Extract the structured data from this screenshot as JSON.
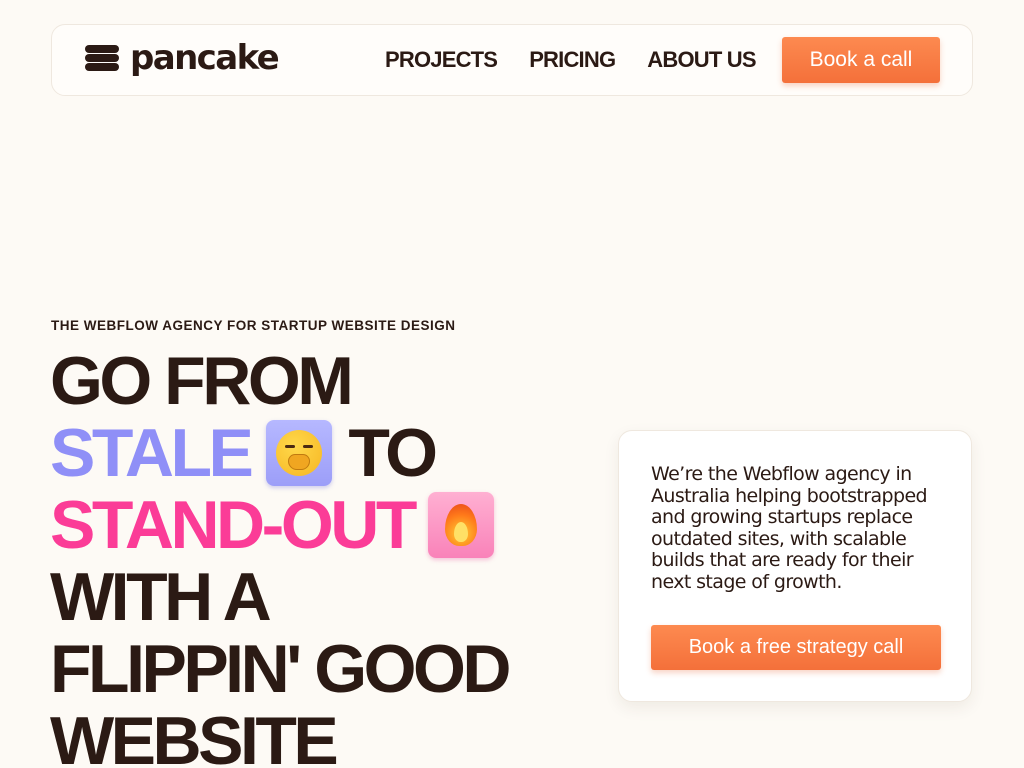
{
  "brand": {
    "name": "pancake"
  },
  "nav": {
    "links": [
      "PROJECTS",
      "PRICING",
      "ABOUT US"
    ],
    "cta": "Book a call"
  },
  "hero": {
    "eyebrow": "THE WEBFLOW AGENCY FOR STARTUP WEBSITE DESIGN",
    "headline": {
      "line1": "GO FROM",
      "stale": "STALE",
      "to": "TO",
      "standout": "STAND-OUT",
      "line4": "WITH A",
      "line5": "FLIPPIN' GOOD",
      "line6": "WEBSITE"
    },
    "icons": [
      "yawning-face-icon",
      "fire-icon"
    ]
  },
  "card": {
    "text": "We’re the Webflow agency in Australia helping bootstrapped and growing startups replace outdated sites, with scalable builds that are ready for their next stage of growth.",
    "cta": "Book a free strategy call"
  },
  "colors": {
    "background": "#fdfaf5",
    "text": "#2b1a14",
    "accent_orange": "#f97a3f",
    "stale_purple": "#8f8ff7",
    "standout_pink": "#fb3c97"
  }
}
